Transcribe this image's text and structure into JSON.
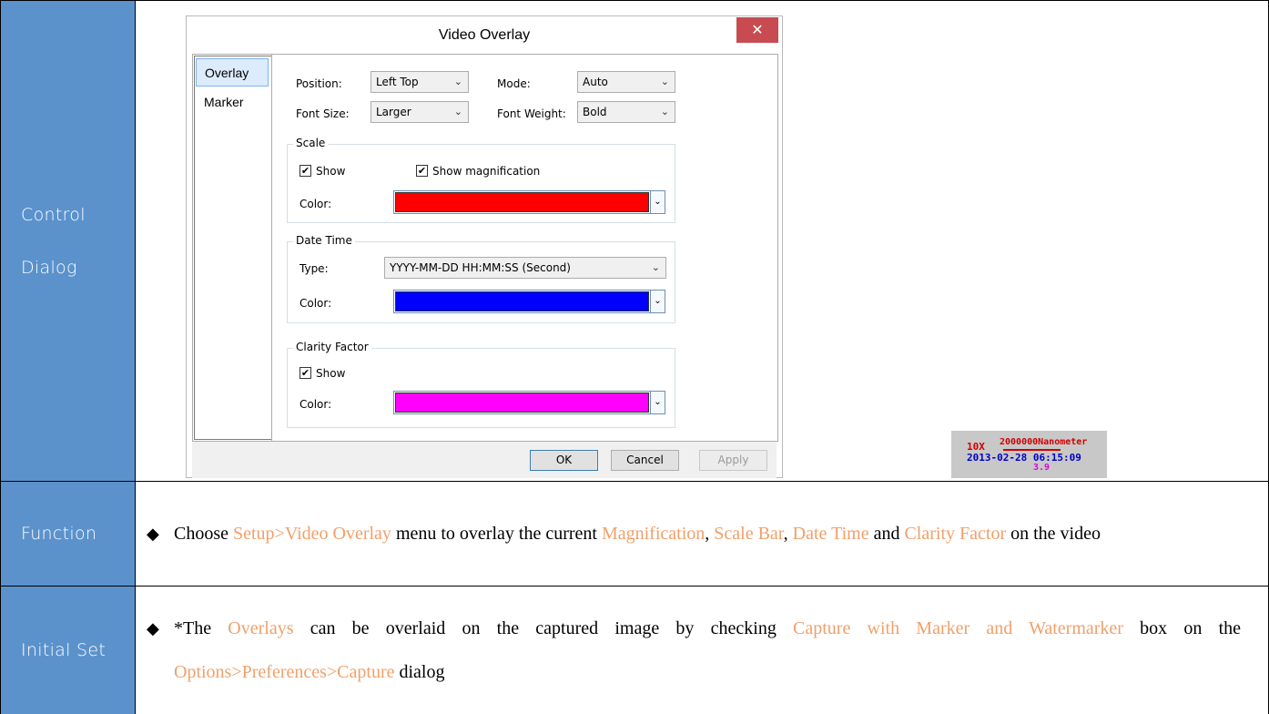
{
  "rows": {
    "control_label_line1": "Control",
    "control_label_line2": "Dialog",
    "function_label": "Function",
    "initial_label": "Initial Set"
  },
  "dialog": {
    "title": "Video Overlay",
    "close_glyph": "✕",
    "nav": [
      "Overlay",
      "Marker"
    ],
    "position_label": "Position:",
    "position_value": "Left Top",
    "mode_label": "Mode:",
    "mode_value": "Auto",
    "font_size_label": "Font Size:",
    "font_size_value": "Larger",
    "font_weight_label": "Font Weight:",
    "font_weight_value": "Bold",
    "scale": {
      "group_label": "Scale",
      "show_label": "Show",
      "show_checked": true,
      "show_mag_label": "Show magnification",
      "show_mag_checked": true,
      "color_label": "Color:",
      "color": "#ff0000"
    },
    "datetime": {
      "group_label": "Date Time",
      "type_label": "Type:",
      "type_value": "YYYY-MM-DD HH:MM:SS (Second)",
      "color_label": "Color:",
      "color": "#0000ff"
    },
    "clarity": {
      "group_label": "Clarity Factor",
      "show_label": "Show",
      "show_checked": true,
      "color_label": "Color:",
      "color": "#ff00ff"
    },
    "buttons": {
      "ok": "OK",
      "cancel": "Cancel",
      "apply": "Apply"
    }
  },
  "sample_overlay": {
    "magnification": "10X",
    "scale_text": "2000000Nanometer",
    "datetime": "2013-02-28 06:15:09",
    "clarity": "3.9",
    "colors": {
      "scale": "#d00000",
      "datetime": "#0000c8",
      "clarity": "#e000e0"
    }
  },
  "function_text": {
    "p1": "Choose ",
    "h1": "Setup>Video Overlay",
    "p2": " menu to overlay the current ",
    "h2": "Magnification",
    "p3": ", ",
    "h3": "Scale Bar",
    "p4": ", ",
    "h4": "Date Time",
    "p5": " and ",
    "h5": "Clarity Factor",
    "p6": " on the video"
  },
  "initial_text": {
    "p1": "*The ",
    "h1": "Overlays",
    "p2": " can be overlaid on the captured image by checking ",
    "h2": "Capture with Marker and Watermarker",
    "p3": " box on the ",
    "h3": "Options>Preferences>Capture",
    "p4": " dialog"
  },
  "bullet_glyph": "◆",
  "highlight_color": "#f0a06a",
  "label_bg_color": "#5b92cc"
}
